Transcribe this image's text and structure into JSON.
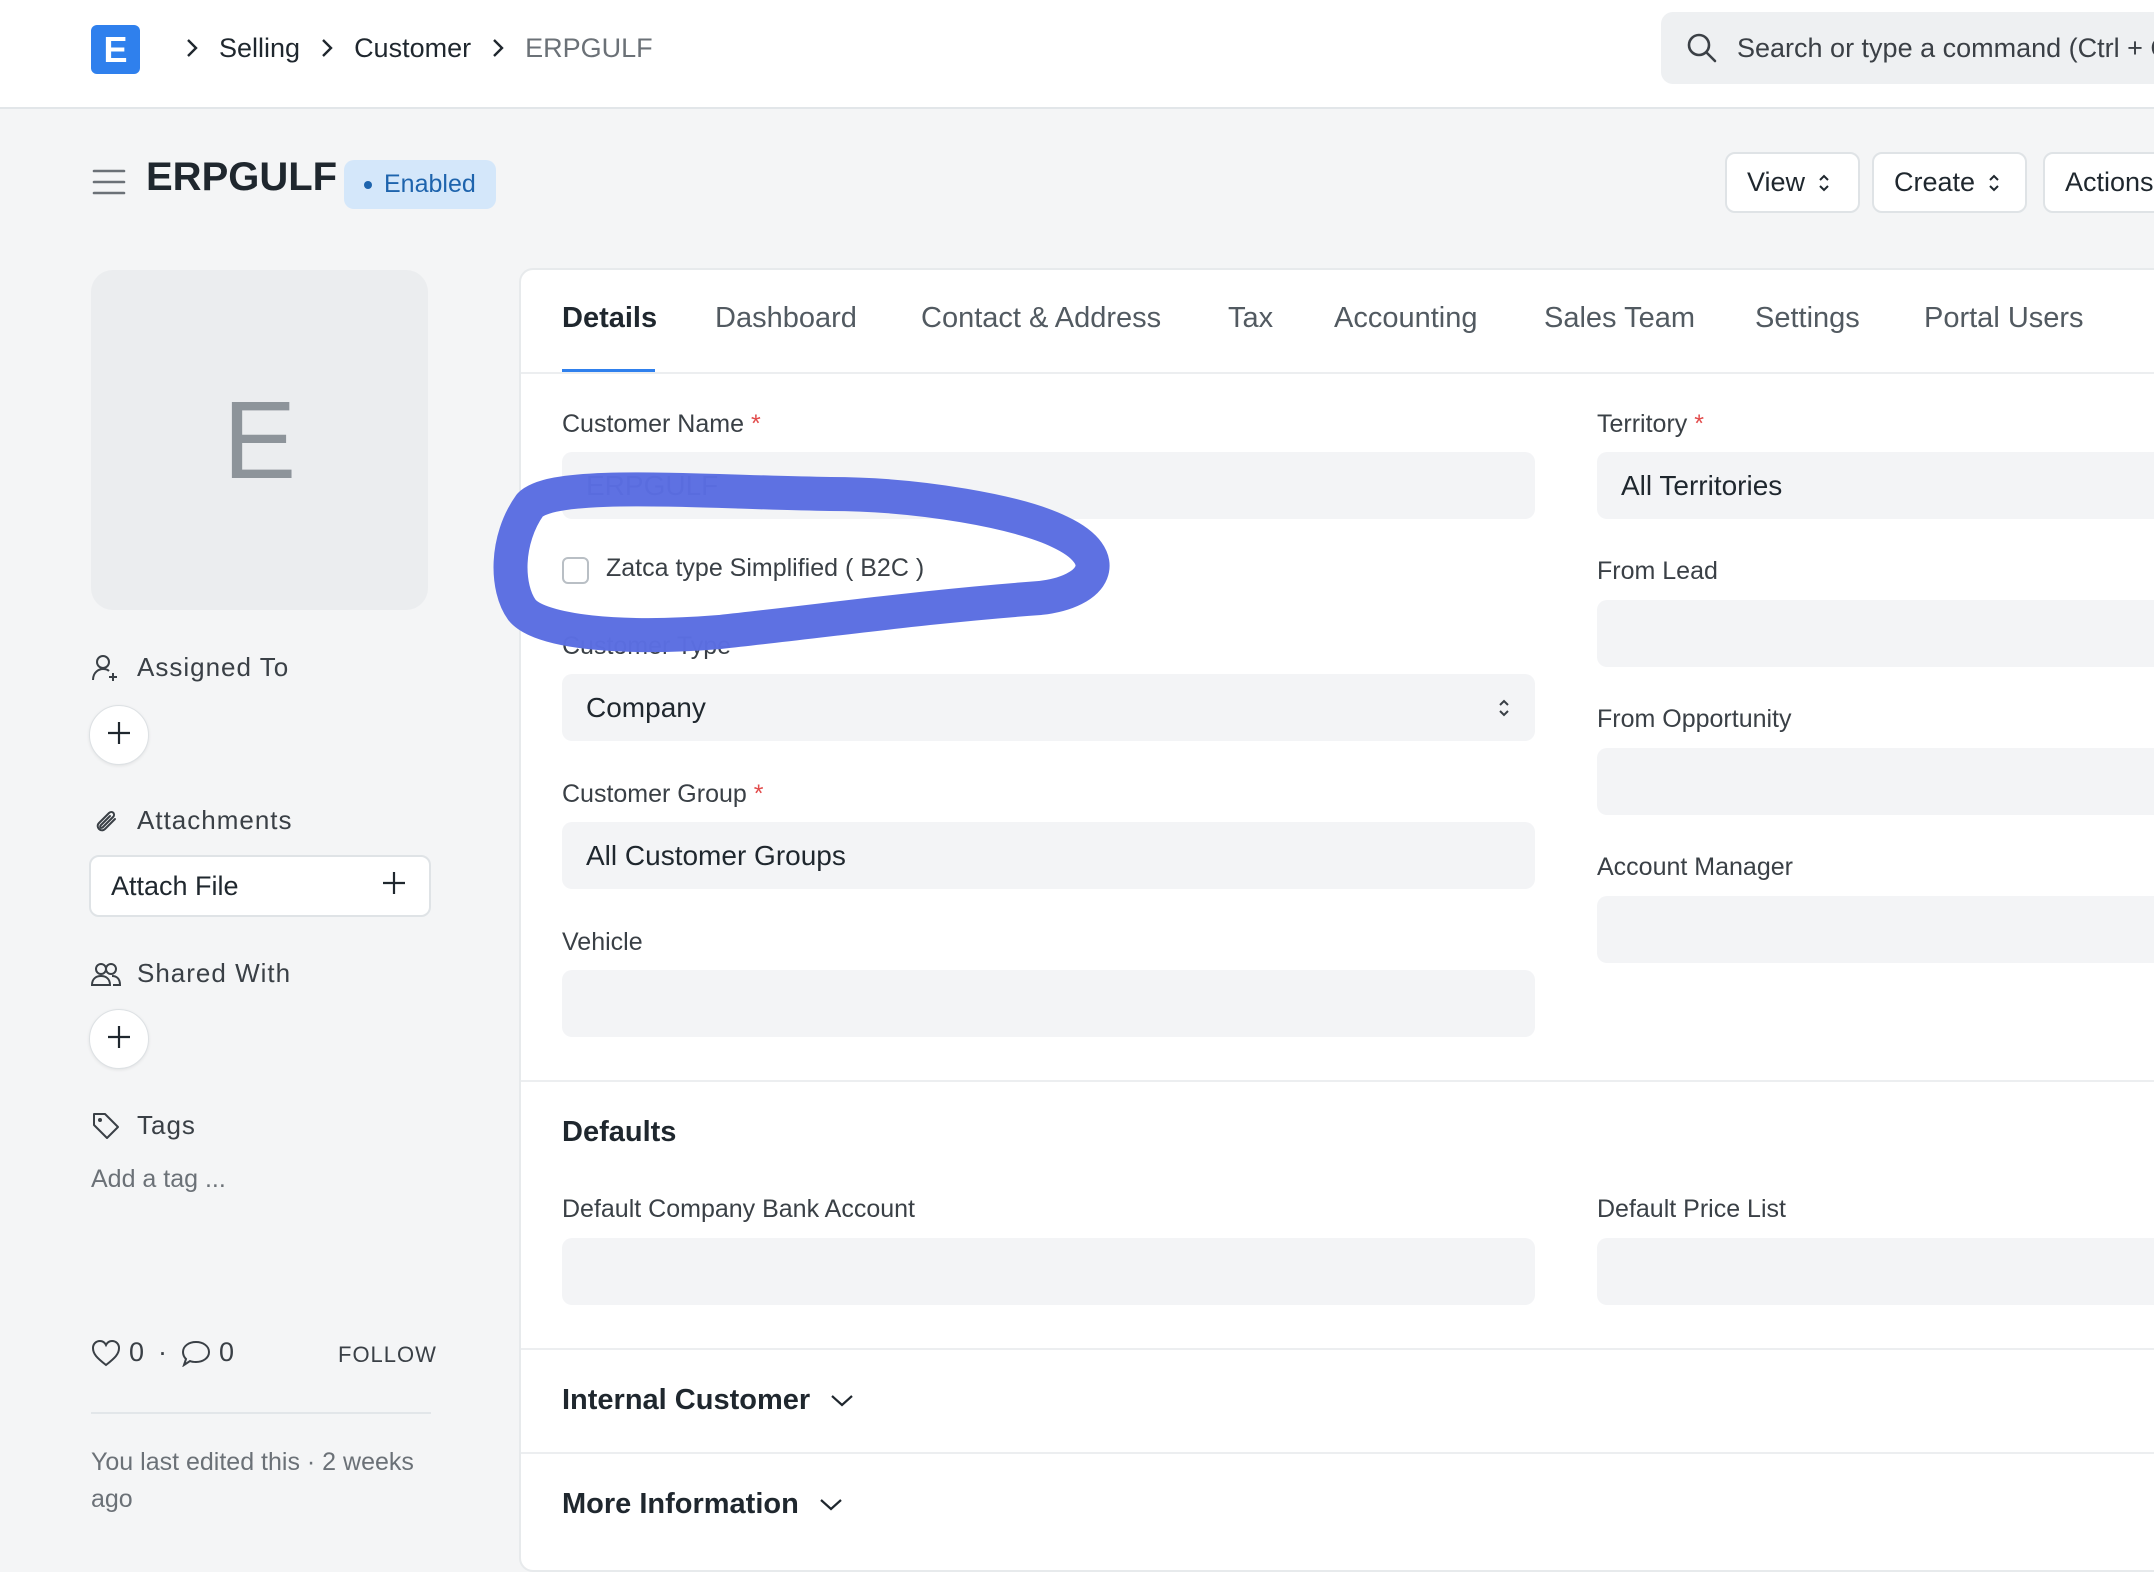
{
  "app": {
    "logo_letter": "E",
    "brand_color": "#2f80ed"
  },
  "breadcrumb": [
    "Selling",
    "Customer",
    "ERPGULF"
  ],
  "search": {
    "placeholder": "Search or type a command (Ctrl + G)"
  },
  "header": {
    "title": "ERPGULF",
    "status": "Enabled",
    "buttons": {
      "view": "View",
      "create": "Create",
      "actions": "Actions"
    }
  },
  "sidebar": {
    "avatar_letter": "E",
    "assigned_to": "Assigned To",
    "attachments": "Attachments",
    "attach_file": "Attach File",
    "shared_with": "Shared With",
    "tags": "Tags",
    "add_tag": "Add a tag ...",
    "likes": "0",
    "comments": "0",
    "follow": "FOLLOW",
    "last_edited": "You last edited this · 2 weeks ago"
  },
  "tabs": [
    "Details",
    "Dashboard",
    "Contact & Address",
    "Tax",
    "Accounting",
    "Sales Team",
    "Settings",
    "Portal Users"
  ],
  "form": {
    "customer_name": {
      "label": "Customer Name",
      "value": "ERPGULF"
    },
    "zatca": {
      "label": "Zatca type Simplified ( B2C )",
      "checked": false
    },
    "customer_type": {
      "label": "Customer Type",
      "value": "Company"
    },
    "customer_group": {
      "label": "Customer Group",
      "value": "All Customer Groups"
    },
    "vehicle": {
      "label": "Vehicle",
      "value": ""
    },
    "territory": {
      "label": "Territory",
      "value": "All Territories"
    },
    "from_lead": {
      "label": "From Lead",
      "value": ""
    },
    "from_opportunity": {
      "label": "From Opportunity",
      "value": ""
    },
    "account_manager": {
      "label": "Account Manager",
      "value": ""
    }
  },
  "defaults": {
    "title": "Defaults",
    "bank_account": {
      "label": "Default Company Bank Account",
      "value": ""
    },
    "price_list": {
      "label": "Default Price List",
      "value": ""
    }
  },
  "sections": {
    "internal_customer": "Internal Customer",
    "more_information": "More Information"
  },
  "annotation_color": "#5b6ee1"
}
